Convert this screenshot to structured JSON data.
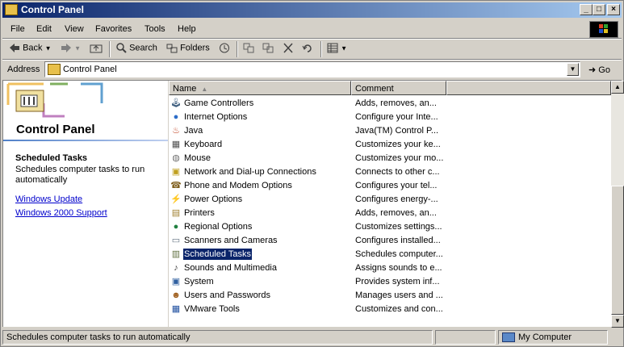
{
  "window": {
    "title": "Control Panel",
    "minimize": "_",
    "maximize": "□",
    "close": "×"
  },
  "menubar": {
    "items": [
      "File",
      "Edit",
      "View",
      "Favorites",
      "Tools",
      "Help"
    ]
  },
  "toolbar": {
    "back": "Back",
    "search": "Search",
    "folders": "Folders"
  },
  "address": {
    "label": "Address",
    "value": "Control Panel",
    "go": "Go"
  },
  "leftpane": {
    "title": "Control Panel",
    "selected_title": "Scheduled Tasks",
    "selected_desc": "Schedules computer tasks to run automatically",
    "links": [
      "Windows Update",
      "Windows 2000 Support"
    ]
  },
  "list": {
    "columns": [
      "Name",
      "Comment"
    ],
    "items": [
      {
        "name": "Game Controllers",
        "comment": "Adds, removes, an...",
        "icon": "game-controller-icon",
        "glyph": "🕹",
        "color": "#406080"
      },
      {
        "name": "Internet Options",
        "comment": "Configure your Inte...",
        "icon": "globe-icon",
        "glyph": "●",
        "color": "#2c6cc8"
      },
      {
        "name": "Java",
        "comment": "Java(TM) Control P...",
        "icon": "java-icon",
        "glyph": "♨",
        "color": "#c04020"
      },
      {
        "name": "Keyboard",
        "comment": "Customizes your ke...",
        "icon": "keyboard-icon",
        "glyph": "▦",
        "color": "#505050"
      },
      {
        "name": "Mouse",
        "comment": "Customizes your mo...",
        "icon": "mouse-icon",
        "glyph": "◍",
        "color": "#707070"
      },
      {
        "name": "Network and Dial-up Connections",
        "comment": "Connects to other c...",
        "icon": "network-icon",
        "glyph": "▣",
        "color": "#c0a020"
      },
      {
        "name": "Phone and Modem Options",
        "comment": "Configures your tel...",
        "icon": "phone-icon",
        "glyph": "☎",
        "color": "#806020"
      },
      {
        "name": "Power Options",
        "comment": "Configures energy-...",
        "icon": "power-icon",
        "glyph": "⚡",
        "color": "#c0a000"
      },
      {
        "name": "Printers",
        "comment": "Adds, removes, an...",
        "icon": "printer-icon",
        "glyph": "▤",
        "color": "#a08030"
      },
      {
        "name": "Regional Options",
        "comment": "Customizes settings...",
        "icon": "regional-globe-icon",
        "glyph": "●",
        "color": "#208040"
      },
      {
        "name": "Scanners and Cameras",
        "comment": "Configures installed...",
        "icon": "scanner-icon",
        "glyph": "▭",
        "color": "#607080"
      },
      {
        "name": "Scheduled Tasks",
        "comment": "Schedules computer...",
        "icon": "scheduled-tasks-icon",
        "glyph": "▥",
        "color": "#607040",
        "selected": true
      },
      {
        "name": "Sounds and Multimedia",
        "comment": "Assigns sounds to e...",
        "icon": "speaker-icon",
        "glyph": "♪",
        "color": "#404040"
      },
      {
        "name": "System",
        "comment": "Provides system inf...",
        "icon": "system-computer-icon",
        "glyph": "▣",
        "color": "#3060a0"
      },
      {
        "name": "Users and Passwords",
        "comment": "Manages users and ...",
        "icon": "users-icon",
        "glyph": "☻",
        "color": "#a06020"
      },
      {
        "name": "VMware Tools",
        "comment": "Customizes and con...",
        "icon": "vmware-icon",
        "glyph": "▦",
        "color": "#2050a0"
      }
    ]
  },
  "status": {
    "text": "Schedules computer tasks to run automatically",
    "zone": "My Computer"
  }
}
